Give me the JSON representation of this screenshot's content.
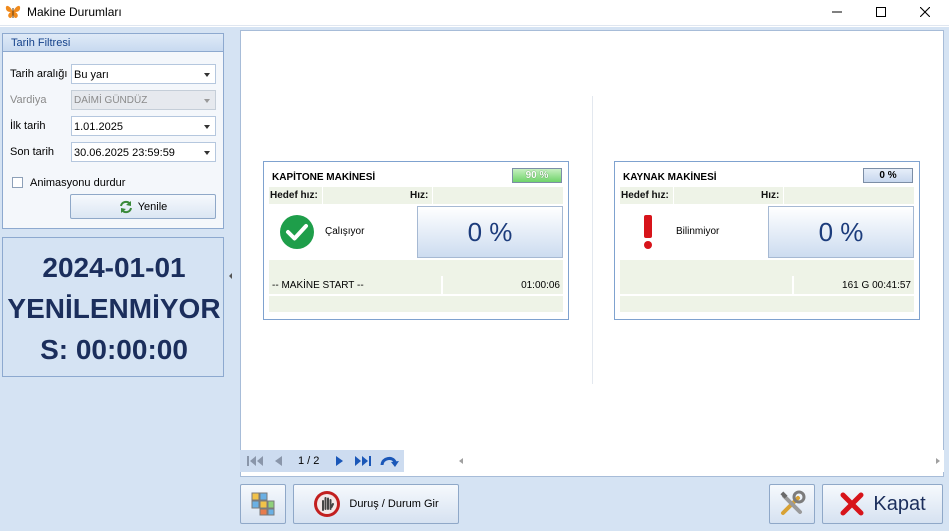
{
  "window": {
    "title": "Makine Durumları",
    "icon": "butterfly-icon"
  },
  "filter": {
    "header": "Tarih Filtresi",
    "date_range_label": "Tarih aralığı",
    "date_range_value": "Bu yarı",
    "shift_label": "Vardiya",
    "shift_value": "DAİMİ GÜNDÜZ",
    "start_label": "İlk tarih",
    "start_value": "1.01.2025",
    "end_label": "Son tarih",
    "end_value": "30.06.2025 23:59:59",
    "stop_anim_label": "Animasyonu durdur",
    "stop_anim_checked": false,
    "refresh_label": "Yenile"
  },
  "status_panel": {
    "line1": "2024-01-01",
    "line2": "YENİLENMİYOR",
    "line3": "S: 00:00:00"
  },
  "machines": [
    {
      "name": "KAPİTONE MAKİNESİ",
      "badge": "90 %",
      "badge_color": "#6fd36a",
      "target_speed_label": "Hedef hız:",
      "speed_label": "Hız:",
      "state": "Çalışıyor",
      "state_icon": "check-circle-icon",
      "efficiency": "0 %",
      "event": "-- MAKİNE START --",
      "duration": "01:00:06"
    },
    {
      "name": "KAYNAK MAKİNESİ",
      "badge": "0 %",
      "badge_color": "#c7d7ee",
      "target_speed_label": "Hedef hız:",
      "speed_label": "Hız:",
      "state": "Bilinmiyor",
      "state_icon": "exclamation-icon",
      "efficiency": "0 %",
      "event": "",
      "duration": "161 G 00:41:57"
    }
  ],
  "pager": {
    "page_label": "1 / 2"
  },
  "toolbar": {
    "durus_label": "Duruş / Durum Gir",
    "close_label": "Kapat"
  }
}
